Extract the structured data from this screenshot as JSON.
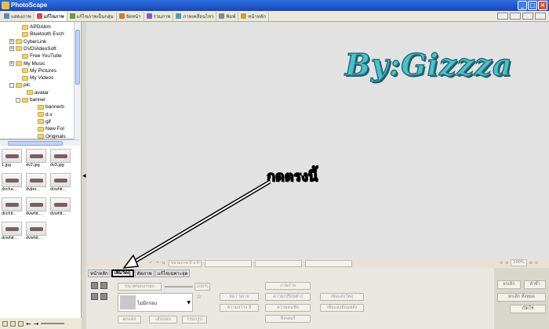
{
  "window": {
    "title": "PhotoScape"
  },
  "tabs": [
    {
      "label": "แสดงภาพ",
      "color": "#5a8ac8"
    },
    {
      "label": "แก้ไขภาพ",
      "color": "#c84a4a",
      "active": true
    },
    {
      "label": "แก้ไขภาพเป็นกลุ่ม",
      "color": "#6a9a4a"
    },
    {
      "label": "จัดหน้า",
      "color": "#c87a3a"
    },
    {
      "label": "รวมภาพ",
      "color": "#8a5ac8"
    },
    {
      "label": "ภาพเคลื่อนไหว",
      "color": "#4aa0b8"
    },
    {
      "label": "พิมพ์",
      "color": "#888888"
    },
    {
      "label": "หน้าหลัก",
      "color": "#c8a03a"
    }
  ],
  "tree": {
    "items": [
      {
        "label": "APDAbm",
        "expander": ""
      },
      {
        "label": "Bluetooth Exch",
        "expander": ""
      },
      {
        "label": "CyberLink",
        "expander": "+"
      },
      {
        "label": "DVDVideoSoft",
        "expander": "+"
      },
      {
        "label": "Free YouTube",
        "expander": ""
      },
      {
        "label": "My Music",
        "expander": "+"
      },
      {
        "label": "My Pictures",
        "expander": ""
      },
      {
        "label": "My Videos",
        "expander": ""
      },
      {
        "label": "pic",
        "expander": "-"
      },
      {
        "label": "avatar",
        "expander": ""
      },
      {
        "label": "banner",
        "expander": "-"
      },
      {
        "label": "bannerb",
        "expander": ""
      },
      {
        "label": "d.v",
        "expander": ""
      },
      {
        "label": "gif",
        "expander": ""
      },
      {
        "label": "New Fol",
        "expander": ""
      },
      {
        "label": "Originals",
        "expander": ""
      }
    ]
  },
  "thumbnails": [
    "1.jpg",
    "dv2.jpg",
    "dv3.jpg",
    "dvcha...",
    "dvjter...",
    "dvwhit...",
    "dvchit...",
    "dvwhit...",
    "dvwhit...",
    "dvwhit...",
    "dvwhit..."
  ],
  "canvas": {
    "watermark": "By:Gizzza",
    "annotation": "กดตรงนี้"
  },
  "status": {
    "size": "ขนาดภาพ 0 x 0",
    "zoom": "100%"
  },
  "tool_panel": {
    "tabs": [
      "หน้าหลัก",
      "เพิ่มวัตถุ",
      "ตัดภาพ",
      "แก้ไขเฉพาะจุด"
    ],
    "active_tab_index": 1,
    "frame_label": "ขนาดขอบกรอบ",
    "opacity": "100%",
    "preset_label": "ไม่มีกรอบ",
    "btn_save": "ตกแต่ง",
    "btn_line": "เส้นขอบ",
    "btn_round": "กรอบรูป",
    "col2": [
      "ย่อ / ขยาย",
      "ความสว่าง สี"
    ],
    "col3": [
      "ภาพถ่าย",
      "ความเปรียบต่าง",
      "ความคมชัด",
      "ฟิลเตอร์"
    ],
    "col4": [
      "เพิ่มแสงวัตถุ",
      "เพิ่มแสงย้อนหลัง"
    ]
  },
  "right_panel": {
    "btn1": "ยกเลิก",
    "btn2": "ทำซ้ำ",
    "btn3": "ยกเลิก ทั้งหมด",
    "btn4": "เปิดใช้"
  }
}
